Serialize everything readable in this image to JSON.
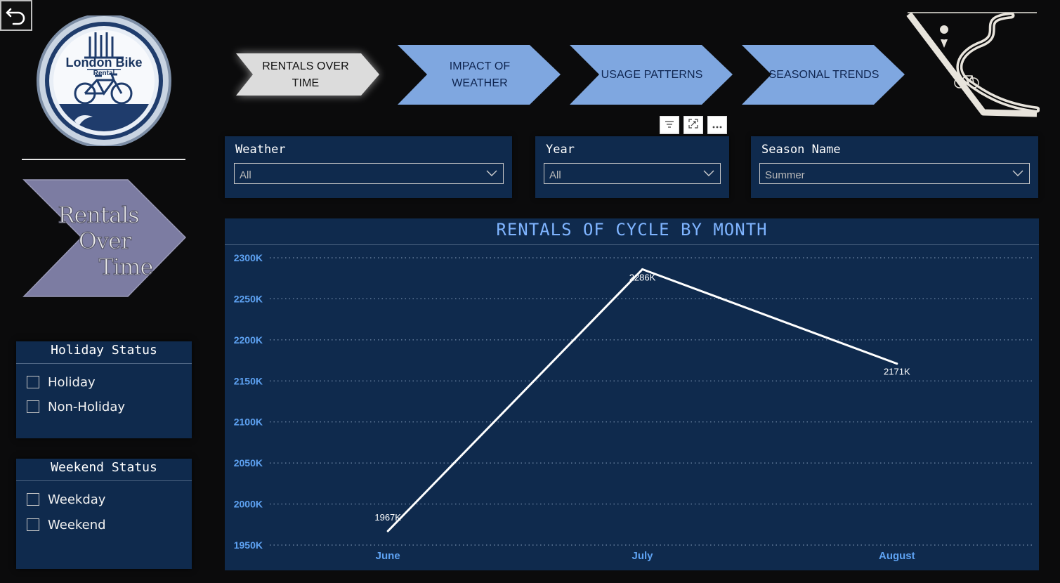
{
  "logo": {
    "line1": "London Bike",
    "line2": "Rental"
  },
  "page_badge": {
    "line1": "Rentals",
    "line2": "Over",
    "line3": "Time"
  },
  "nav": [
    {
      "line1": "RENTALS OVER",
      "line2": "TIME",
      "active": true
    },
    {
      "line1": "IMPACT OF",
      "line2": "WEATHER",
      "active": false
    },
    {
      "line1": "USAGE PATTERNS",
      "line2": "",
      "active": false
    },
    {
      "line1": "SEASONAL TRENDS",
      "line2": "",
      "active": false
    }
  ],
  "visual_header": {
    "icons": [
      "filter-icon",
      "focus-mode-icon",
      "more-options-icon"
    ]
  },
  "slicers": {
    "weather": {
      "title": "Weather",
      "value": "All"
    },
    "year": {
      "title": "Year",
      "value": "All"
    },
    "season": {
      "title": "Season Name",
      "value": "Summer"
    }
  },
  "holiday": {
    "title": "Holiday Status",
    "options": [
      "Holiday",
      "Non-Holiday"
    ]
  },
  "weekend": {
    "title": "Weekend Status",
    "options": [
      "Weekday",
      "Weekend"
    ]
  },
  "colors": {
    "panel": "#0f2a4d",
    "accent": "#7fb4ff",
    "tick": "#5ea2f2",
    "nav_arrow": "#7fa7e0",
    "nav_active": "#dcdcdc"
  },
  "chart_data": {
    "type": "line",
    "title": "RENTALS OF CYCLE BY MONTH",
    "categories": [
      "June",
      "July",
      "August"
    ],
    "series": [
      {
        "values": [
          1967,
          2286,
          2171
        ],
        "labels": [
          "1967K",
          "2286K",
          "2171K"
        ]
      }
    ],
    "y_ticks": [
      "2300K",
      "2250K",
      "2200K",
      "2150K",
      "2100K",
      "2050K",
      "2000K",
      "1950K"
    ],
    "y_tick_values": [
      2300,
      2250,
      2200,
      2150,
      2100,
      2050,
      2000,
      1950
    ],
    "ylim": [
      1950,
      2300
    ],
    "grid": true,
    "unit": "K"
  }
}
